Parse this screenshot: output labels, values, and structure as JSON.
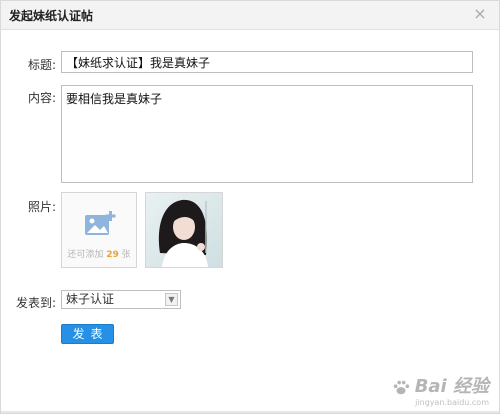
{
  "dialog": {
    "title": "发起妹纸认证帖",
    "close_glyph": "×"
  },
  "form": {
    "title_label": "标题:",
    "title_value": "【妹纸求认证】我是真妹子",
    "content_label": "内容:",
    "content_value": "要相信我是真妹子",
    "photos_label": "照片:",
    "add_photo_prefix": "还可添加",
    "add_photo_count": "29",
    "add_photo_suffix": "张",
    "publish_to_label": "发表到:",
    "publish_to_value": "妹子认证",
    "submit_label": "发表"
  },
  "watermark": {
    "brand": "Bai  经验",
    "url": "jingyan.baidu.com"
  },
  "icons": {
    "close": "close-icon",
    "add_photo": "image-plus-icon",
    "dropdown": "chevron-down-icon",
    "watermark": "baidu-paw-icon"
  },
  "colors": {
    "accent": "#2590e6",
    "count_highlight": "#f0a030",
    "add_icon": "#8fb5dd"
  }
}
